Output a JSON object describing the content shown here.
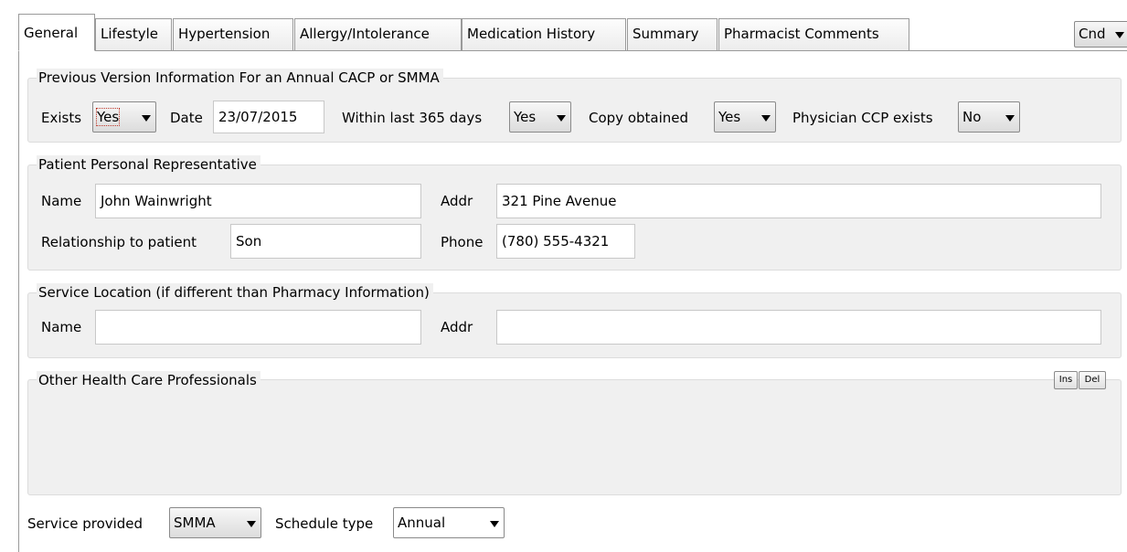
{
  "tabs": [
    {
      "label": "General",
      "active": true
    },
    {
      "label": "Lifestyle",
      "active": false
    },
    {
      "label": "Hypertension",
      "active": false
    },
    {
      "label": "Allergy/Intolerance",
      "active": false
    },
    {
      "label": "Medication History",
      "active": false
    },
    {
      "label": "Summary",
      "active": false
    },
    {
      "label": "Pharmacist Comments",
      "active": false
    }
  ],
  "cnd_menu": {
    "label": "Cnd",
    "icon": "dropdown-arrow-icon"
  },
  "previous_version": {
    "title": "Previous Version Information For an Annual CACP or SMMA",
    "exists_label": "Exists",
    "exists_value": "Yes",
    "date_label": "Date",
    "date_value": "23/07/2015",
    "within_label": "Within last 365 days",
    "within_value": "Yes",
    "copy_label": "Copy obtained",
    "copy_value": "Yes",
    "physician_label": "Physician CCP exists",
    "physician_value": "No"
  },
  "representative": {
    "title": "Patient Personal Representative",
    "name_label": "Name",
    "name_value": "John Wainwright",
    "addr_label": "Addr",
    "addr_value": "321 Pine Avenue",
    "relationship_label": "Relationship to patient",
    "relationship_value": "Son",
    "phone_label": "Phone",
    "phone_value": "(780) 555-4321"
  },
  "service_location": {
    "title": "Service Location (if different than Pharmacy Information)",
    "name_label": "Name",
    "name_value": "",
    "addr_label": "Addr",
    "addr_value": ""
  },
  "other_professionals": {
    "title": "Other Health Care Professionals",
    "ins_label": "Ins",
    "del_label": "Del"
  },
  "footer": {
    "service_label": "Service provided",
    "service_value": "SMMA",
    "schedule_label": "Schedule type",
    "schedule_value": "Annual"
  }
}
